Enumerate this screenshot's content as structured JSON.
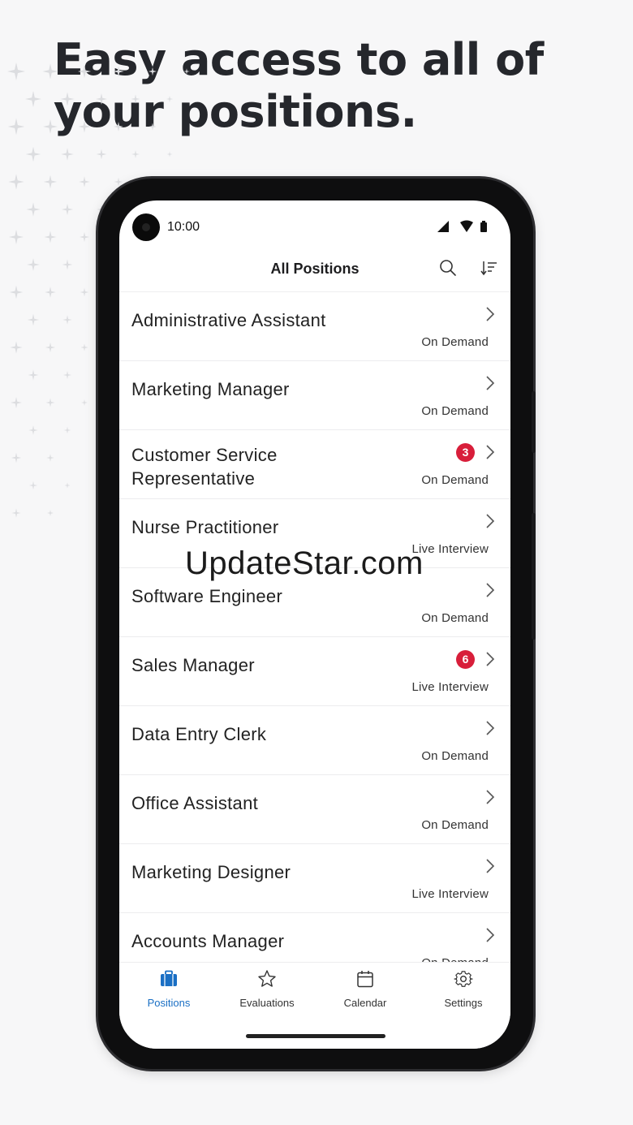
{
  "headline": "Easy access to all of your positions.",
  "status": {
    "time": "10:00"
  },
  "header": {
    "title": "All Positions"
  },
  "positions": [
    {
      "title": "Administrative Assistant",
      "type": "On Demand",
      "badge": ""
    },
    {
      "title": "Marketing Manager",
      "type": "On Demand",
      "badge": ""
    },
    {
      "title": "Customer Service Representative",
      "type": "On Demand",
      "badge": "3"
    },
    {
      "title": "Nurse Practitioner",
      "type": "Live Interview",
      "badge": ""
    },
    {
      "title": "Software Engineer",
      "type": "On Demand",
      "badge": ""
    },
    {
      "title": "Sales Manager",
      "type": "Live Interview",
      "badge": "6"
    },
    {
      "title": "Data Entry Clerk",
      "type": "On Demand",
      "badge": ""
    },
    {
      "title": "Office Assistant",
      "type": "On Demand",
      "badge": ""
    },
    {
      "title": "Marketing Designer",
      "type": "Live Interview",
      "badge": ""
    },
    {
      "title": "Accounts Manager",
      "type": "On Demand",
      "badge": ""
    }
  ],
  "tabs": [
    {
      "label": "Positions",
      "icon": "briefcase-icon",
      "active": true
    },
    {
      "label": "Evaluations",
      "icon": "star-icon",
      "active": false
    },
    {
      "label": "Calendar",
      "icon": "calendar-icon",
      "active": false
    },
    {
      "label": "Settings",
      "icon": "gear-icon",
      "active": false
    }
  ],
  "watermark": "UpdateStar.com",
  "colors": {
    "accent": "#1a6fc4",
    "badge": "#d81e3a",
    "text": "#222222"
  }
}
